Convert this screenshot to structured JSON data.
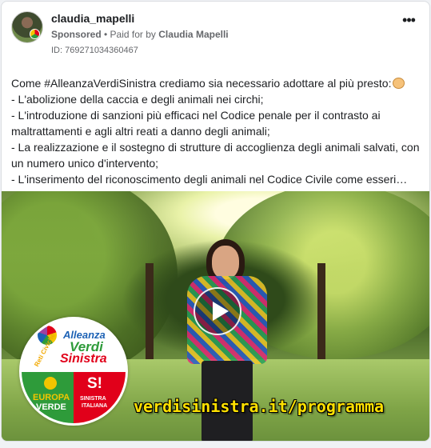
{
  "post": {
    "username": "claudia_mapelli",
    "sponsored_label": "Sponsored",
    "paid_prefix": "• Paid for by",
    "paid_by": "Claudia Mapelli",
    "ad_id": "ID: 769271034360467",
    "more_icon": "more-options-icon",
    "more_label": "•••"
  },
  "body": {
    "lines": [
      "Come #AlleanzaVerdiSinistra crediamo sia necessario adottare al più presto:",
      "- L'abolizione della caccia e degli animali nei circhi;",
      "- L'introduzione di sanzioni più efficaci nel Codice penale per il contrasto ai",
      "maltrattamenti e agli altri reati a danno degli animali;",
      "- La realizzazione e il sostegno di strutture di accoglienza degli animali salvati, con",
      "un numero unico d'intervento;",
      "- L'inserimento del riconoscimento degli animali nel Codice Civile come esseri…"
    ],
    "emoji": "dog-face-emoji"
  },
  "video": {
    "play_icon": "play-icon",
    "url_overlay": "verdisinistra.it/programma",
    "logo": {
      "alleanza": "Alleanza",
      "verdi": "Verdi",
      "sinistra": "Sinistra",
      "reti": "Reti Civiche",
      "europa": "EUROPA",
      "verde": "VERDE",
      "si": "S!",
      "sinistra_line": "SINISTRA",
      "italiana": "ITALIANA"
    }
  },
  "colors": {
    "url_yellow": "#ffe100",
    "green": "#2e9b3a",
    "red": "#e1001a",
    "blue": "#1d62b5"
  }
}
